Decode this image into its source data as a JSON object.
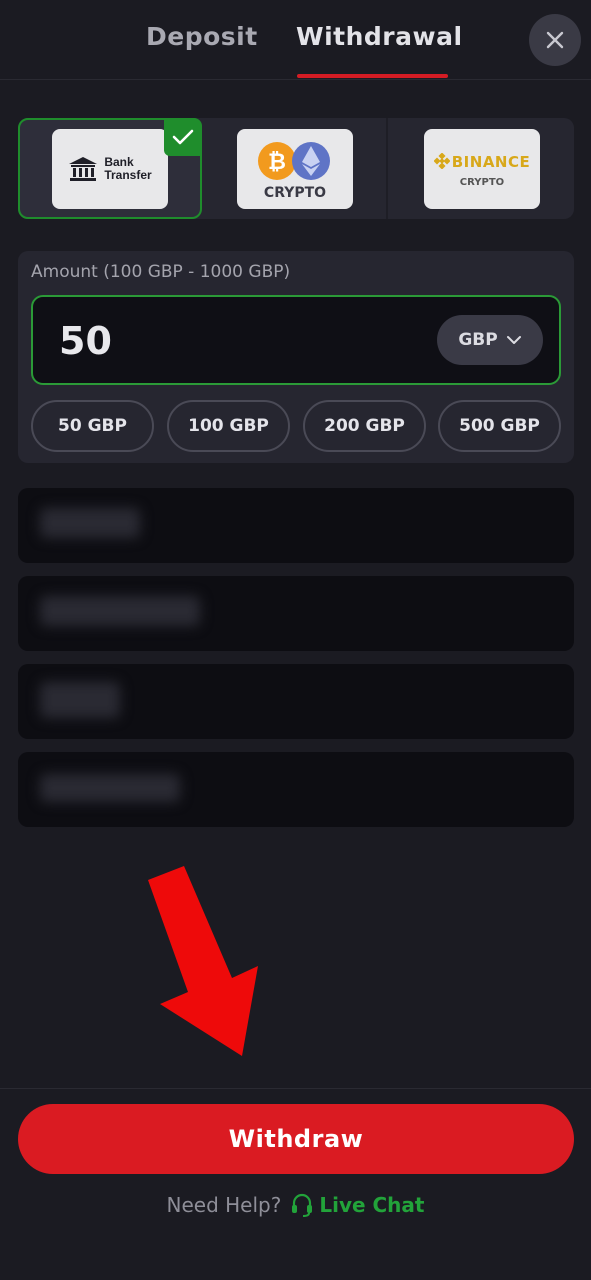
{
  "tabs": {
    "deposit": "Deposit",
    "withdrawal": "Withdrawal",
    "active": "withdrawal"
  },
  "payment_methods": [
    {
      "label_line1": "Bank",
      "label_line2": "Transfer",
      "selected": true,
      "icon": "bank-icon"
    },
    {
      "label": "CRYPTO",
      "selected": false,
      "icon": "crypto-icon"
    },
    {
      "label": "BINANCE",
      "sublabel": "CRYPTO",
      "selected": false,
      "icon": "binance-icon"
    }
  ],
  "amount": {
    "label": "Amount (100 GBP - 1000 GBP)",
    "value": "50",
    "currency": "GBP"
  },
  "quick_amounts": [
    "50 GBP",
    "100 GBP",
    "200 GBP",
    "500 GBP"
  ],
  "withdraw_button": "Withdraw",
  "help": {
    "text": "Need Help?",
    "live_chat": "Live Chat"
  },
  "colors": {
    "accent_red": "#da1b22",
    "accent_green": "#22a33a",
    "background": "#1b1b22"
  }
}
